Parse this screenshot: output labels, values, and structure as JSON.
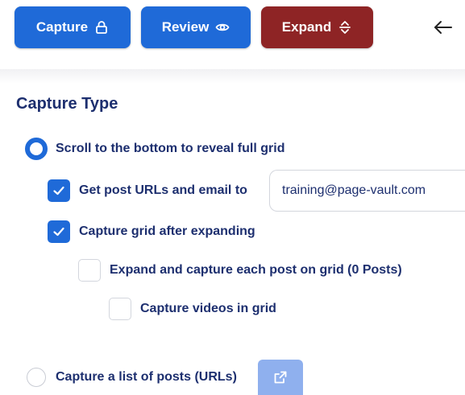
{
  "toolbar": {
    "capture_label": "Capture",
    "review_label": "Review",
    "expand_label": "Expand"
  },
  "capture_type": {
    "title": "Capture Type",
    "scroll_option": {
      "label": "Scroll to the bottom to reveal full grid",
      "selected": true
    },
    "get_urls": {
      "label": "Get post URLs and email to",
      "checked": true,
      "email_value": "training@page-vault.com"
    },
    "capture_grid": {
      "label": "Capture grid after expanding",
      "checked": true
    },
    "expand_each": {
      "label": "Expand and capture each post on grid (0 Posts)",
      "checked": false
    },
    "capture_videos": {
      "label": "Capture videos in grid",
      "checked": false
    },
    "list_option": {
      "label": "Capture a list of posts (URLs)",
      "selected": false
    }
  },
  "colors": {
    "primary": "#1f6ad8",
    "expand": "#8e2425",
    "text": "#1d2f6f",
    "list_button": "#8fb0ee"
  },
  "icons": {
    "capture": "lock-icon",
    "review": "eye-icon",
    "expand": "expand-vertical-icon",
    "back": "arrow-left-icon",
    "list": "open-external-icon",
    "check": "checkmark-icon"
  }
}
